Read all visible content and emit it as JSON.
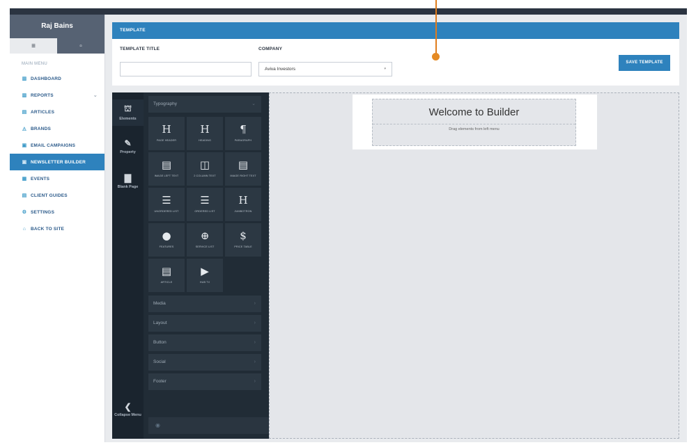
{
  "sidebar": {
    "user_name": "Raj Bains",
    "tab_icons": [
      "≡",
      "▫"
    ],
    "menu_label": "MAIN MENU",
    "items": [
      {
        "label": "DASHBOARD",
        "icon": "bar-chart-icon",
        "glyph": "▥",
        "active": false,
        "chevron": ""
      },
      {
        "label": "REPORTS",
        "icon": "bar-chart-icon",
        "glyph": "▥",
        "active": false,
        "chevron": "⌄"
      },
      {
        "label": "ARTICLES",
        "icon": "grid-icon",
        "glyph": "▤",
        "active": false,
        "chevron": ""
      },
      {
        "label": "BRANDS",
        "icon": "tag-icon",
        "glyph": "◬",
        "active": false,
        "chevron": ""
      },
      {
        "label": "EMAIL CAMPAIGNS",
        "icon": "envelope-icon",
        "glyph": "▣",
        "active": false,
        "chevron": ""
      },
      {
        "label": "NEWSLETTER BUILDER",
        "icon": "newsletter-icon",
        "glyph": "▣",
        "active": true,
        "chevron": ""
      },
      {
        "label": "EVENTS",
        "icon": "calendar-icon",
        "glyph": "▦",
        "active": false,
        "chevron": ""
      },
      {
        "label": "CLIENT GUIDES",
        "icon": "book-icon",
        "glyph": "▤",
        "active": false,
        "chevron": ""
      },
      {
        "label": "SETTINGS",
        "icon": "gear-icon",
        "glyph": "⚙",
        "active": false,
        "chevron": ""
      },
      {
        "label": "BACK TO SITE",
        "icon": "home-icon",
        "glyph": "⌂",
        "active": false,
        "chevron": ""
      }
    ]
  },
  "template": {
    "header": "TEMPLATE",
    "title_label": "TEMPLATE TITLE",
    "title_value": "",
    "company_label": "COMPANY",
    "company_value": "Aviva Investors",
    "dropdown_glyph": "▾",
    "save_label": "SAVE TEMPLATE"
  },
  "builder": {
    "rail": {
      "elements": {
        "label": "Elements",
        "glyph": "⛫"
      },
      "property": {
        "label": "Property",
        "glyph": "✎"
      },
      "blank_page": {
        "label": "Blank Page",
        "glyph": "▇"
      },
      "collapse": {
        "label": "Collapse Menu",
        "glyph": "❮"
      }
    },
    "typography": {
      "label": "Typography",
      "chevron": "⌄"
    },
    "tiles": [
      {
        "glyph": "H",
        "label": "PAGE HEADER",
        "icon": "heading-icon"
      },
      {
        "glyph": "H",
        "label": "HEADING",
        "icon": "heading-icon"
      },
      {
        "glyph": "¶",
        "label": "PARAGRAPH",
        "icon": "paragraph-icon"
      },
      {
        "glyph": "▤",
        "label": "IMAGE LEFT TEXT",
        "icon": "image-left-text-icon"
      },
      {
        "glyph": "◫",
        "label": "2 COLUMN TEXT",
        "icon": "two-column-icon"
      },
      {
        "glyph": "▤",
        "label": "IMAGE RIGHT TEXT",
        "icon": "image-right-text-icon"
      },
      {
        "glyph": "☰",
        "label": "UNORDERED LIST",
        "icon": "unordered-list-icon"
      },
      {
        "glyph": "☰",
        "label": "ORDERED LIST",
        "icon": "ordered-list-icon"
      },
      {
        "glyph": "H",
        "label": "JUMBOTRON",
        "icon": "jumbotron-icon"
      },
      {
        "glyph": "●",
        "label": "FEATURES",
        "icon": "features-icon"
      },
      {
        "glyph": "⊕",
        "label": "SERVICE LIST",
        "icon": "service-list-icon"
      },
      {
        "glyph": "$",
        "label": "PRICE TABLE",
        "icon": "price-table-icon"
      },
      {
        "glyph": "▤",
        "label": "ARTICLE",
        "icon": "article-icon"
      },
      {
        "glyph": "▶",
        "label": "HUB TV",
        "icon": "video-icon"
      }
    ],
    "sections": [
      "Media",
      "Layout",
      "Button",
      "Social",
      "Footer"
    ],
    "section_chevron": "›",
    "footer_glyph": "◉",
    "canvas": {
      "title": "Welcome to Builder",
      "subtitle": "Drag elements from left menu"
    }
  }
}
